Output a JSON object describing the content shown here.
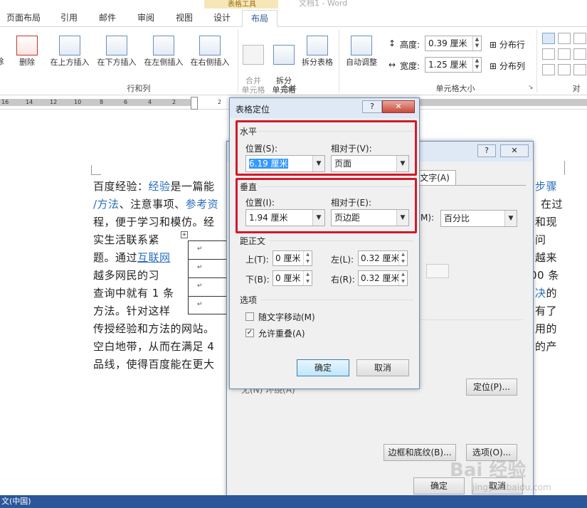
{
  "ribbon": {
    "context_label": "表格工具",
    "doc_title": "文档1 - Word",
    "tabs": [
      "页面布局",
      "引用",
      "邮件",
      "审阅",
      "视图",
      "设计",
      "布局"
    ],
    "active_tab": "布局",
    "partial_left": "除",
    "buttons": {
      "delete": "删除",
      "insert_above": "在上方插入",
      "insert_below": "在下方插入",
      "insert_left": "在左侧插入",
      "insert_right": "在右侧插入",
      "merge_cells": "合并\n单元格",
      "split_cells": "拆分\n单元格",
      "split_table": "拆分表格",
      "autofit": "自动调整",
      "distribute_rows": "分布行",
      "distribute_cols": "分布列"
    },
    "height_label": "高度:",
    "height_value": "0.39 厘米",
    "width_label": "宽度:",
    "width_value": "1.25 厘米",
    "groups": {
      "rows_cols": "行和列",
      "merge": "合并",
      "cell_size": "单元格大小",
      "align_partial": "对"
    }
  },
  "ruler": {
    "numbers": [
      "16",
      "14",
      "12",
      "10",
      "8",
      "6",
      "4",
      "2",
      "2"
    ]
  },
  "document": {
    "line1": [
      "百度经验：",
      "经验",
      "是一篇能",
      "步骤"
    ],
    "line2": [
      "/方法",
      "、注意事项、",
      "参考资",
      "在过"
    ],
    "line3": [
      "程，便于学习和模仿。经",
      "和现"
    ],
    "line4": [
      "实生活联系紧",
      "问"
    ],
    "line5": [
      "题。通过",
      "互联网",
      "越来"
    ],
    "line6": [
      "越多网民的习",
      "00 条"
    ],
    "line7": [
      "查询中就有 1 条",
      "决",
      "的"
    ],
    "line8": [
      "方法。针对这样",
      "有了"
    ],
    "line9": [
      "传授经验和方法的网站。",
      "用的"
    ],
    "line10": [
      "空白地带，从而在满足 4",
      "的产"
    ],
    "line11": [
      "品线，使得百度能在更大"
    ]
  },
  "back_dialog": {
    "tab_partial": "文字(A)",
    "measure_unit_label": "M):",
    "measure_unit_value": "百分比",
    "partial_text": "无(N)        环绕(A)",
    "position_button": "定位(P)...",
    "borders_button": "边框和底纹(B)...",
    "options_button": "选项(O)...",
    "ok": "确定",
    "cancel": "取消"
  },
  "dialog": {
    "title": "表格定位",
    "help": "?",
    "close": "✕",
    "horizontal": {
      "heading": "水平",
      "position_label": "位置(S):",
      "position_value": "6.19 厘米",
      "relative_label": "相对于(V):",
      "relative_value": "页面"
    },
    "vertical": {
      "heading": "垂直",
      "position_label": "位置(I):",
      "position_value": "1.94 厘米",
      "relative_label": "相对于(E):",
      "relative_value": "页边距"
    },
    "distance": {
      "heading": "距正文",
      "top_label": "上(T):",
      "top_value": "0 厘米",
      "bottom_label": "下(B):",
      "bottom_value": "0 厘米",
      "left_label": "左(L):",
      "left_value": "0.32 厘米",
      "right_label": "右(R):",
      "right_value": "0.32 厘米"
    },
    "options": {
      "heading": "选项",
      "move_with_text": "随文字移动(M)",
      "move_with_text_checked": false,
      "allow_overlap": "允许重叠(A)",
      "allow_overlap_checked": true
    },
    "ok": "确定",
    "cancel": "取消"
  },
  "statusbar": {
    "language": "文(中国)"
  },
  "watermark": {
    "text": "Bai 经验",
    "url": "jingyan.baidu.com"
  }
}
